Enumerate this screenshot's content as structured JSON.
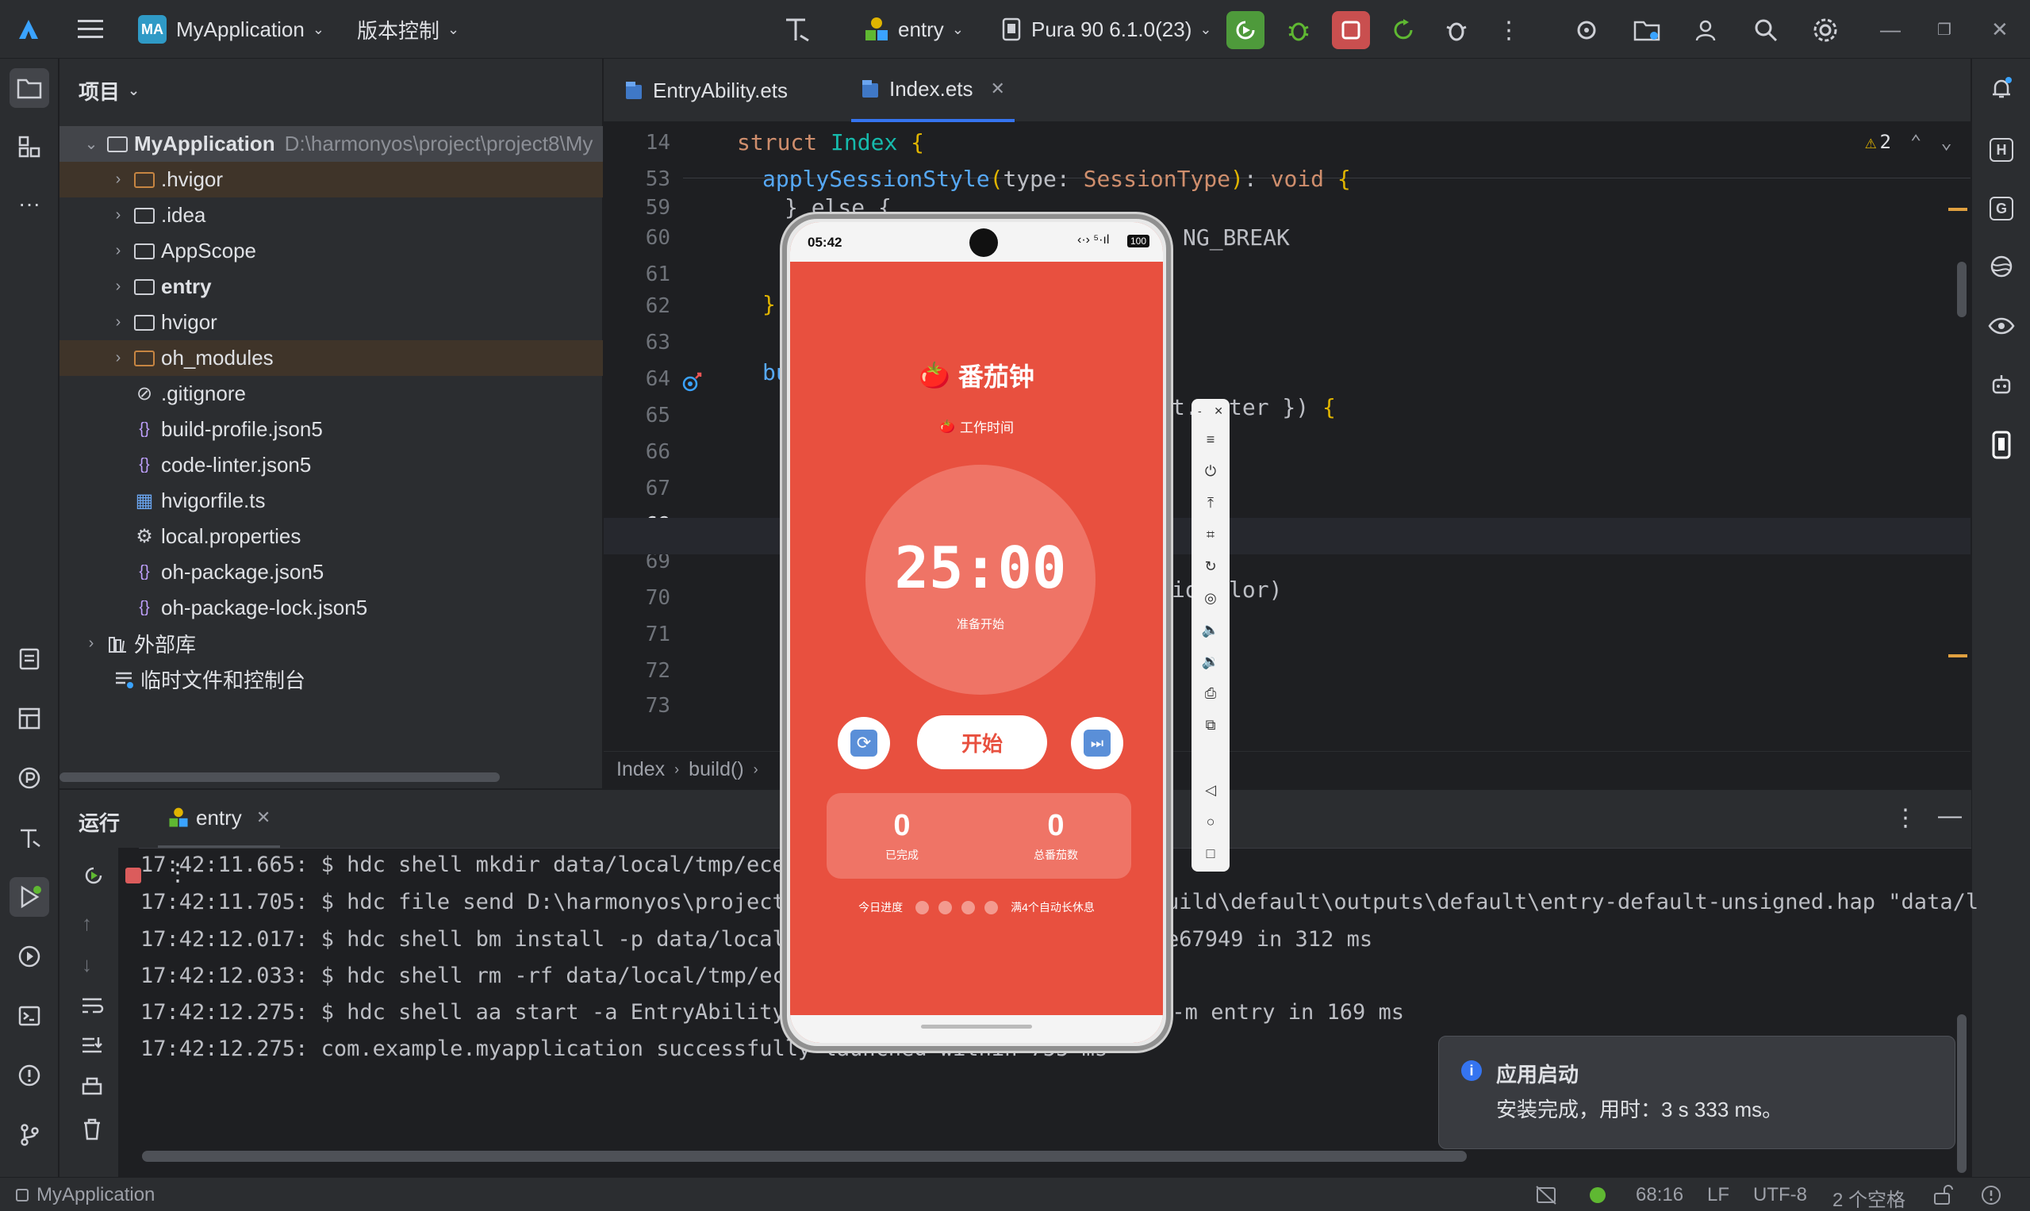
{
  "topbar": {
    "project_badge": "MA",
    "project_name": "MyApplication",
    "vcs": "版本控制",
    "run_config": "entry",
    "device": "Pura 90 6.1.0(23)"
  },
  "project_panel": {
    "title": "项目",
    "root": {
      "name": "MyApplication",
      "path": "D:\\harmonyos\\project\\project8\\My"
    },
    "items": [
      {
        "label": ".hvigor",
        "kind": "folder-orange",
        "expandable": true
      },
      {
        "label": ".idea",
        "kind": "folder",
        "expandable": true
      },
      {
        "label": "AppScope",
        "kind": "folder",
        "expandable": true
      },
      {
        "label": "entry",
        "kind": "module",
        "expandable": true
      },
      {
        "label": "hvigor",
        "kind": "folder",
        "expandable": true
      },
      {
        "label": "oh_modules",
        "kind": "folder-orange",
        "expandable": true
      },
      {
        "label": ".gitignore",
        "kind": "ignore",
        "expandable": false
      },
      {
        "label": "build-profile.json5",
        "kind": "json",
        "expandable": false
      },
      {
        "label": "code-linter.json5",
        "kind": "json",
        "expandable": false
      },
      {
        "label": "hvigorfile.ts",
        "kind": "ts",
        "expandable": false
      },
      {
        "label": "local.properties",
        "kind": "settings",
        "expandable": false
      },
      {
        "label": "oh-package.json5",
        "kind": "json",
        "expandable": false
      },
      {
        "label": "oh-package-lock.json5",
        "kind": "json",
        "expandable": false
      }
    ],
    "external_libs": "外部库",
    "scratches": "临时文件和控制台"
  },
  "editor": {
    "tabs": [
      {
        "label": "EntryAbility.ets",
        "active": false
      },
      {
        "label": "Index.ets",
        "active": true
      }
    ],
    "warnings": "2",
    "line_numbers": [
      "14",
      "53",
      "59",
      "60",
      "61",
      "62",
      "63",
      "64",
      "65",
      "66",
      "67",
      "68",
      "69",
      "70",
      "71",
      "72",
      "73"
    ],
    "code": {
      "l14_kw": "struct",
      "l14_name": "Index",
      "l14_brace": "{",
      "l53_fn": "applySessionStyle",
      "l53_param": "type",
      "l53_type": "SessionType",
      "l53_ret": "void",
      "l59": "} else {",
      "l60": "NG_BREAK",
      "l62": "}",
      "l64": "bu",
      "l65": "t.",
      "l65b": "ter })",
      "l70": "io",
      "l70b": "lor)"
    },
    "breadcrumb": [
      "Index",
      "build()"
    ]
  },
  "run_panel": {
    "title": "运行",
    "tab": "entry",
    "lines": [
      "17:42:11.665: $ hdc shell mkdir data/local/tmp/ece",
      "17:42:11.705: $ hdc file send D:\\harmonyos\\project\\",
      "17:42:12.017: $ hdc shell bm install -p data/local/",
      "17:42:12.033: $ hdc shell rm -rf data/local/tmp/ece",
      "17:42:12.275: $ hdc shell aa start -a EntryAbility -b com.example.myapplication -m entry in 169 ms",
      "17:42:12.275: com.example.myapplication successfully launched within 755 ms"
    ],
    "line2_tail": "uild\\default\\outputs\\default\\entry-default-unsigned.hap \"data/l",
    "line3_tail": "e67949 in 312 ms"
  },
  "notification": {
    "title": "应用启动",
    "body": "安装完成，用时：3 s 333 ms。"
  },
  "statusbar": {
    "project": "MyApplication",
    "position": "68:16",
    "line_sep": "LF",
    "encoding": "UTF-8",
    "indent": "2 个空格"
  },
  "phone": {
    "time": "05:42",
    "battery": "100",
    "app_title": "番茄钟",
    "mode": "工作时间",
    "timer": "25:00",
    "timer_status": "准备开始",
    "start_label": "开始",
    "completed_value": "0",
    "completed_label": "已完成",
    "total_value": "0",
    "total_label": "总番茄数",
    "progress_label": "今日进度",
    "progress_hint": "满4个自动长休息",
    "progress_dots": 4,
    "progress_done": 0
  },
  "colors": {
    "accent_red": "#e8503f",
    "ide_bg": "#1e1f22",
    "panel_bg": "#2b2d30",
    "run_green": "#5fb832",
    "stop_red": "#db5c5c"
  }
}
